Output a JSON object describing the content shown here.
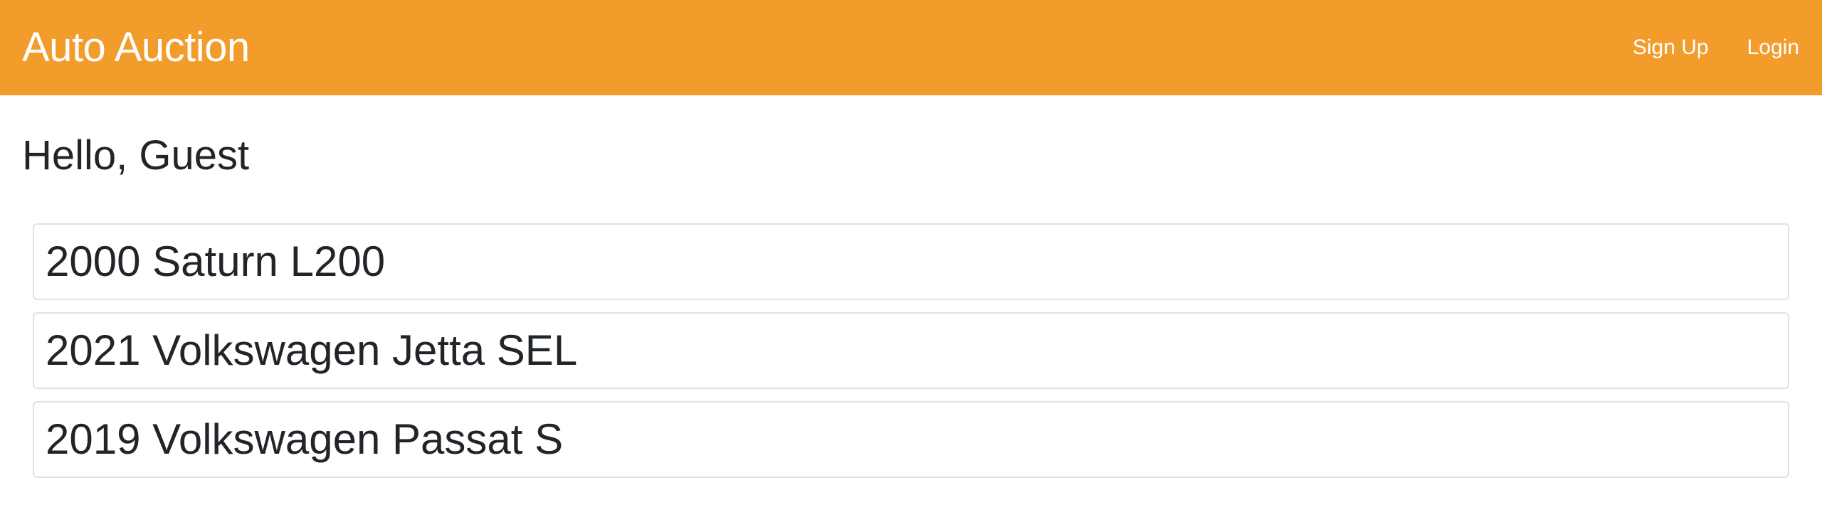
{
  "navbar": {
    "brand": "Auto Auction",
    "links": [
      {
        "label": "Sign Up"
      },
      {
        "label": "Login"
      }
    ],
    "background_color": "#f29c2c"
  },
  "main": {
    "greeting": "Hello, Guest",
    "cars": [
      {
        "title": "2000 Saturn L200"
      },
      {
        "title": "2021 Volkswagen Jetta SEL"
      },
      {
        "title": "2019 Volkswagen Passat S"
      }
    ]
  }
}
